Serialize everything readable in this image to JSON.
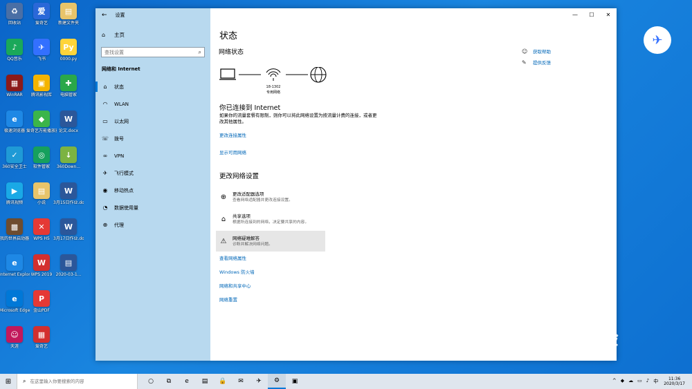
{
  "desktop": {
    "icons": [
      {
        "label": "回收站",
        "color": "#4a6fa5",
        "glyph": "♻"
      },
      {
        "label": "爱奇艺",
        "color": "#2a68d8",
        "glyph": "爱"
      },
      {
        "label": "新建文件夹",
        "color": "#e8c46a",
        "glyph": "▤"
      },
      {
        "label": "QQ音乐",
        "color": "#1aa85a",
        "glyph": "♪"
      },
      {
        "label": "飞书",
        "color": "#3370ff",
        "glyph": "✈"
      },
      {
        "label": "0000.py",
        "color": "#ffd43b",
        "glyph": "Py"
      },
      {
        "label": "WinRAR",
        "color": "#8b1a1a",
        "glyph": "▦"
      },
      {
        "label": "腾讯影视库",
        "color": "#f4b400",
        "glyph": "▣"
      },
      {
        "label": "电脑管家",
        "color": "#2aa84a",
        "glyph": "✚"
      },
      {
        "label": "极速浏览器",
        "color": "#1e88e5",
        "glyph": "e"
      },
      {
        "label": "爱奇艺万能播放器",
        "color": "#3bb54a",
        "glyph": "◆"
      },
      {
        "label": "论文.docx",
        "color": "#2b579a",
        "glyph": "W"
      },
      {
        "label": "360安全卫士",
        "color": "#1f9ad6",
        "glyph": "✓"
      },
      {
        "label": "软件管家",
        "color": "#16a05d",
        "glyph": "◎"
      },
      {
        "label": "360Down...",
        "color": "#7cb342",
        "glyph": "↓"
      },
      {
        "label": "腾讯视频",
        "color": "#1aa9e6",
        "glyph": "▶"
      },
      {
        "label": "小说",
        "color": "#e8c46a",
        "glyph": "▤"
      },
      {
        "label": "3月15日作业.docx",
        "color": "#2b579a",
        "glyph": "W"
      },
      {
        "label": "我的世界启动器",
        "color": "#6d4c2f",
        "glyph": "▩"
      },
      {
        "label": "WPS H5",
        "color": "#e53935",
        "glyph": "✕"
      },
      {
        "label": "3月17日作业.docx",
        "color": "#2b579a",
        "glyph": "W"
      },
      {
        "label": "Internet Explorer",
        "color": "#1e88e5",
        "glyph": "e"
      },
      {
        "label": "WPS 2019",
        "color": "#d32f2f",
        "glyph": "W"
      },
      {
        "label": "2020-03-1...",
        "color": "#2b579a",
        "glyph": "▤"
      },
      {
        "label": "Microsoft Edge",
        "color": "#0078d7",
        "glyph": "e"
      },
      {
        "label": "金山PDF",
        "color": "#e53935",
        "glyph": "P"
      },
      {
        "label": "",
        "color": "",
        "glyph": ""
      },
      {
        "label": "天涯",
        "color": "#c2185b",
        "glyph": "☺"
      },
      {
        "label": "爱奇艺",
        "color": "#d32f2f",
        "glyph": "▦"
      }
    ]
  },
  "window": {
    "app_title": "设置",
    "home_label": "主页",
    "search_placeholder": "查找设置",
    "section_label": "网络和 Internet",
    "nav": [
      {
        "label": "状态",
        "icon": "⌂"
      },
      {
        "label": "WLAN",
        "icon": "◠"
      },
      {
        "label": "以太网",
        "icon": "▭"
      },
      {
        "label": "拨号",
        "icon": "☏"
      },
      {
        "label": "VPN",
        "icon": "∞"
      },
      {
        "label": "飞行模式",
        "icon": "✈"
      },
      {
        "label": "移动热点",
        "icon": "◉"
      },
      {
        "label": "数据使用量",
        "icon": "◔"
      },
      {
        "label": "代理",
        "icon": "⊕"
      }
    ],
    "controls": {
      "minimize": "—",
      "maximize": "☐",
      "close": "✕"
    }
  },
  "main": {
    "page_title": "状态",
    "network_status_heading": "网络状态",
    "network_name": "18-1302",
    "network_type": "专用网络",
    "connected_title": "你已连接到 Internet",
    "connected_desc": "如果你的流量套餐有限制，则你可以将此网络设置为按流量计费的连接，或者更改其他属性。",
    "link_change_props": "更改连接属性",
    "link_show_networks": "显示可用网络",
    "change_heading": "更改网络设置",
    "options": [
      {
        "icon": "⊕",
        "title": "更改适配器选项",
        "desc": "查看网络适配器并更改连接设置。"
      },
      {
        "icon": "⌂",
        "title": "共享选项",
        "desc": "根据所连接到的网络，决定要共享的内容。"
      },
      {
        "icon": "⚠",
        "title": "网络疑难解答",
        "desc": "诊断并解决网络问题。"
      }
    ],
    "links": [
      "查看网络属性",
      "Windows 防火墙",
      "网络和共享中心",
      "网络重置"
    ],
    "help": [
      {
        "icon": "☺",
        "label": "获取帮助"
      },
      {
        "icon": "✎",
        "label": "提供反馈"
      }
    ]
  },
  "taskbar": {
    "start_icon": "⊞",
    "search_placeholder": "在这里输入你要搜索的内容",
    "apps": [
      "○",
      "⧉",
      "e",
      "▤",
      "🔒",
      "✉",
      "✈",
      "⚙",
      "▣"
    ],
    "tray": [
      "^",
      "◆",
      "☁",
      "▭",
      "♪",
      "中"
    ],
    "time": "11:36",
    "date": "2020/3/17"
  },
  "watermark": {
    "big": "Bai du 经验",
    "small": "jingyan.baidu.com"
  }
}
